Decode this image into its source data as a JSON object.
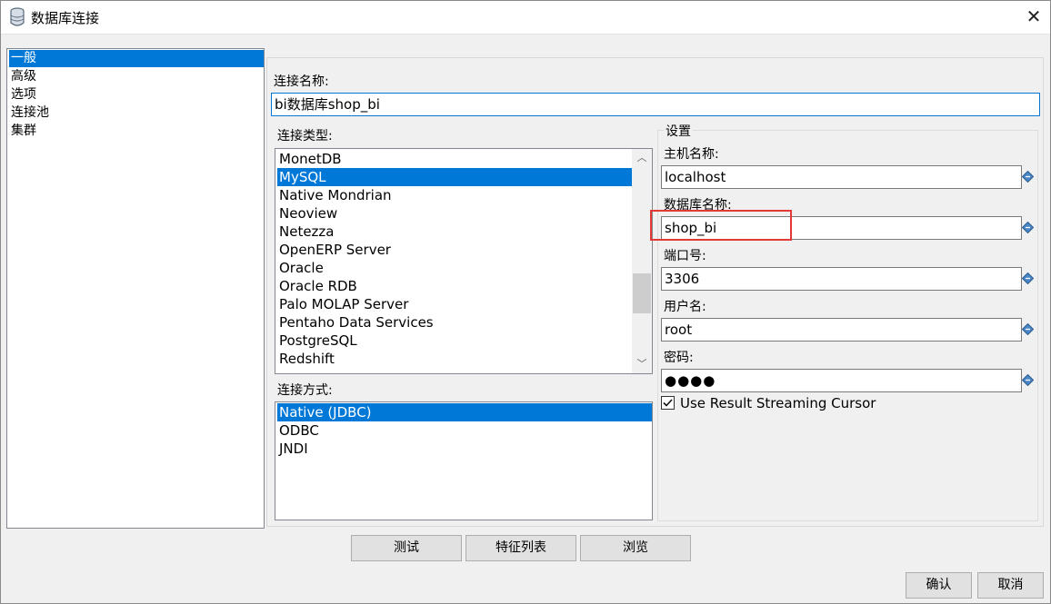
{
  "window": {
    "title": "数据库连接",
    "close_glyph": "✕"
  },
  "nav": {
    "items": [
      "一般",
      "高级",
      "选项",
      "连接池",
      "集群"
    ],
    "selected": "一般"
  },
  "connection_name": {
    "label": "连接名称:",
    "value": "bi数据库shop_bi"
  },
  "connection_type": {
    "label": "连接类型:",
    "items": [
      "MonetDB",
      "MySQL",
      "Native Mondrian",
      "Neoview",
      "Netezza",
      "OpenERP Server",
      "Oracle",
      "Oracle RDB",
      "Palo MOLAP Server",
      "Pentaho Data Services",
      "PostgreSQL",
      "Redshift"
    ],
    "selected": "MySQL"
  },
  "access": {
    "label": "连接方式:",
    "items": [
      "Native (JDBC)",
      "ODBC",
      "JNDI"
    ],
    "selected": "Native (JDBC)"
  },
  "settings": {
    "legend": "设置",
    "host_label": "主机名称:",
    "host_value": "localhost",
    "db_label": "数据库名称:",
    "db_value": "shop_bi",
    "port_label": "端口号:",
    "port_value": "3306",
    "user_label": "用户名:",
    "user_value": "root",
    "password_label": "密码:",
    "password_value": "●●●●",
    "streaming_label": "Use Result Streaming Cursor",
    "streaming_checked": true
  },
  "buttons": {
    "test": "测试",
    "features": "特征列表",
    "browse": "浏览",
    "ok": "确认",
    "cancel": "取消"
  },
  "colors": {
    "selection": "#0078d7",
    "highlight": "#e53935"
  },
  "icons": {
    "title": "database-icon",
    "variable": "variable-diamond-icon"
  }
}
